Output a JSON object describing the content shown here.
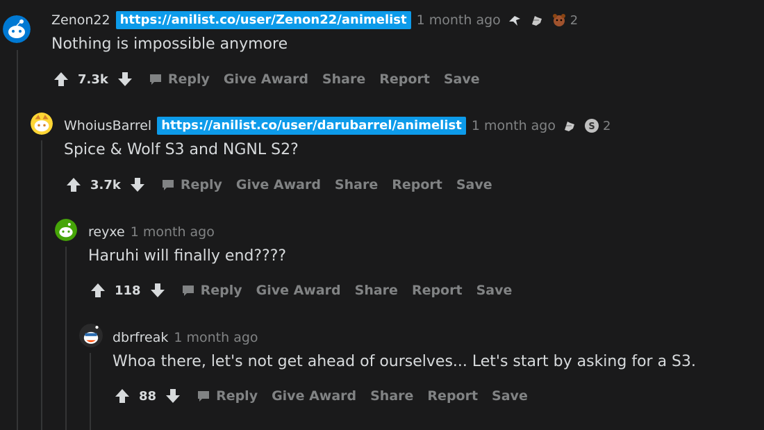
{
  "comments": [
    {
      "username": "Zenon22",
      "flair": "https://anilist.co/user/Zenon22/animelist",
      "time": "1 month ago",
      "award_count": "2",
      "body": "Nothing is impossible anymore",
      "score": "7.3k",
      "avatar_color": "#0079d3"
    },
    {
      "username": "WhoiusBarrel",
      "flair": "https://anilist.co/user/darubarrel/animelist",
      "time": "1 month ago",
      "award_count": "2",
      "body": "Spice & Wolf S3 and NGNL S2?",
      "score": "3.7k",
      "avatar_color": "#ffd635"
    },
    {
      "username": "reyxe",
      "time": "1 month ago",
      "body": "Haruhi will finally end????",
      "score": "118",
      "avatar_color": "#46a508"
    },
    {
      "username": "dbrfreak",
      "time": "1 month ago",
      "body": "Whoa there, let's not get ahead of ourselves... Let's start by asking for a S3.",
      "score": "88",
      "avatar_color": "#ff4500"
    }
  ],
  "actions": {
    "reply": "Reply",
    "give_award": "Give Award",
    "share": "Share",
    "report": "Report",
    "save": "Save"
  },
  "icons": {
    "upvote": "arrow-up-icon",
    "downvote": "arrow-down-icon",
    "reply": "speech-bubble-icon"
  },
  "colors": {
    "background": "#1a1a1b",
    "flair_bg": "#0d9bea",
    "muted_text": "#818384",
    "text": "#d7dadc"
  }
}
